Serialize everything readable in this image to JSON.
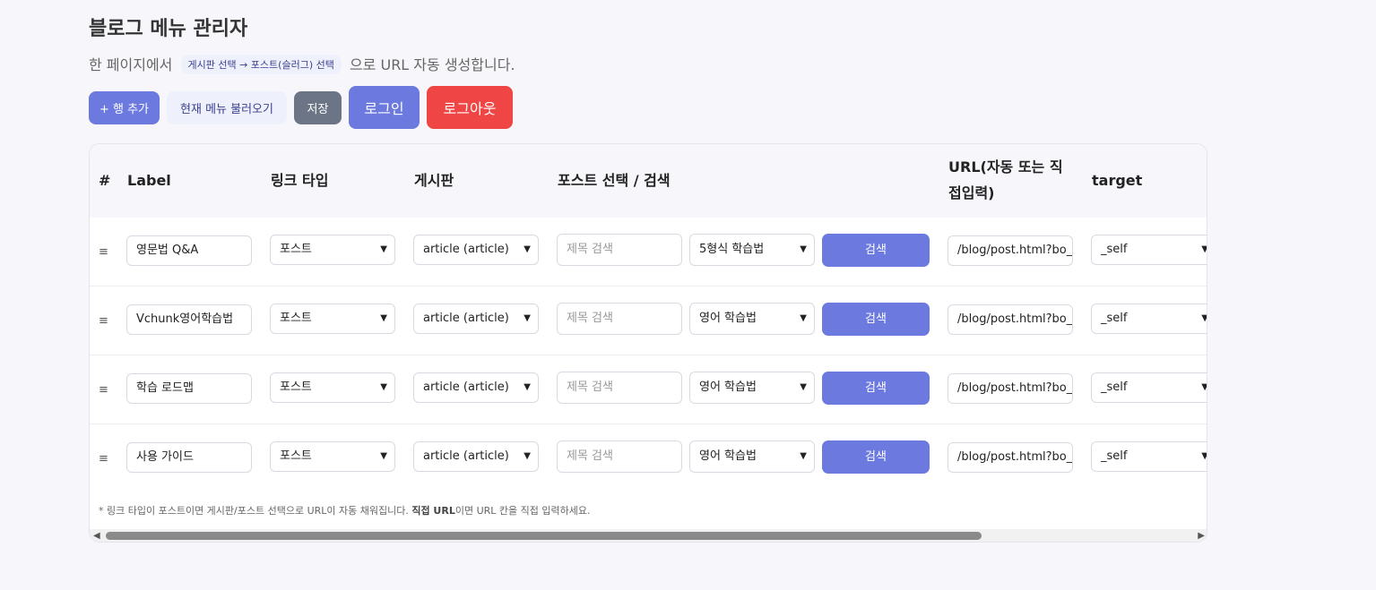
{
  "page": {
    "title": "블로그 메뉴 관리자",
    "subtitle_pre": "한 페이지에서",
    "subtitle_chip": "게시판 선택 → 포스트(슬러그) 선택",
    "subtitle_post": "으로 URL 자동 생성합니다."
  },
  "toolbar": {
    "add_row": "+ 행 추가",
    "load_menu": "현재 메뉴 불러오기",
    "save": "저장",
    "login": "로그인",
    "logout": "로그아웃"
  },
  "table": {
    "headers": {
      "num": "#",
      "label": "Label",
      "link_type": "링크 타입",
      "board": "게시판",
      "post": "포스트 선택 / 검색",
      "url_line1": "URL(자동 또는 직",
      "url_line2": "접입력)",
      "target": "target"
    },
    "handle": "≡",
    "search_placeholder": "제목 검색",
    "search_button": "검색",
    "rows": [
      {
        "label": "영문법 Q&A",
        "link_type": "포스트",
        "board": "article (article)",
        "post": "5형식 학습법",
        "url": "/blog/post.html?bo_table=article",
        "target": "_self"
      },
      {
        "label": "Vchunk영어학습법",
        "link_type": "포스트",
        "board": "article (article)",
        "post": "영어 학습법",
        "url": "/blog/post.html?bo_table=article",
        "target": "_self"
      },
      {
        "label": "학습 로드맵",
        "link_type": "포스트",
        "board": "article (article)",
        "post": "영어 학습법",
        "url": "/blog/post.html?bo_table=article",
        "target": "_self"
      },
      {
        "label": "사용 가이드",
        "link_type": "포스트",
        "board": "article (article)",
        "post": "영어 학습법",
        "url": "/blog/post.html?bo_table=article",
        "target": "_self"
      }
    ]
  },
  "footer_note": {
    "part1": "* 링크 타입이 포스트이면 게시판/포스트 선택으로 URL이 자동 채워집니다.",
    "bold": "직접 URL",
    "part2": "이면 URL 칸을 직접 입력하세요."
  },
  "colors": {
    "primary": "#6c7ae0",
    "danger": "#f04545",
    "secondary": "#6b7585",
    "light_chip": "#eef0fb"
  }
}
